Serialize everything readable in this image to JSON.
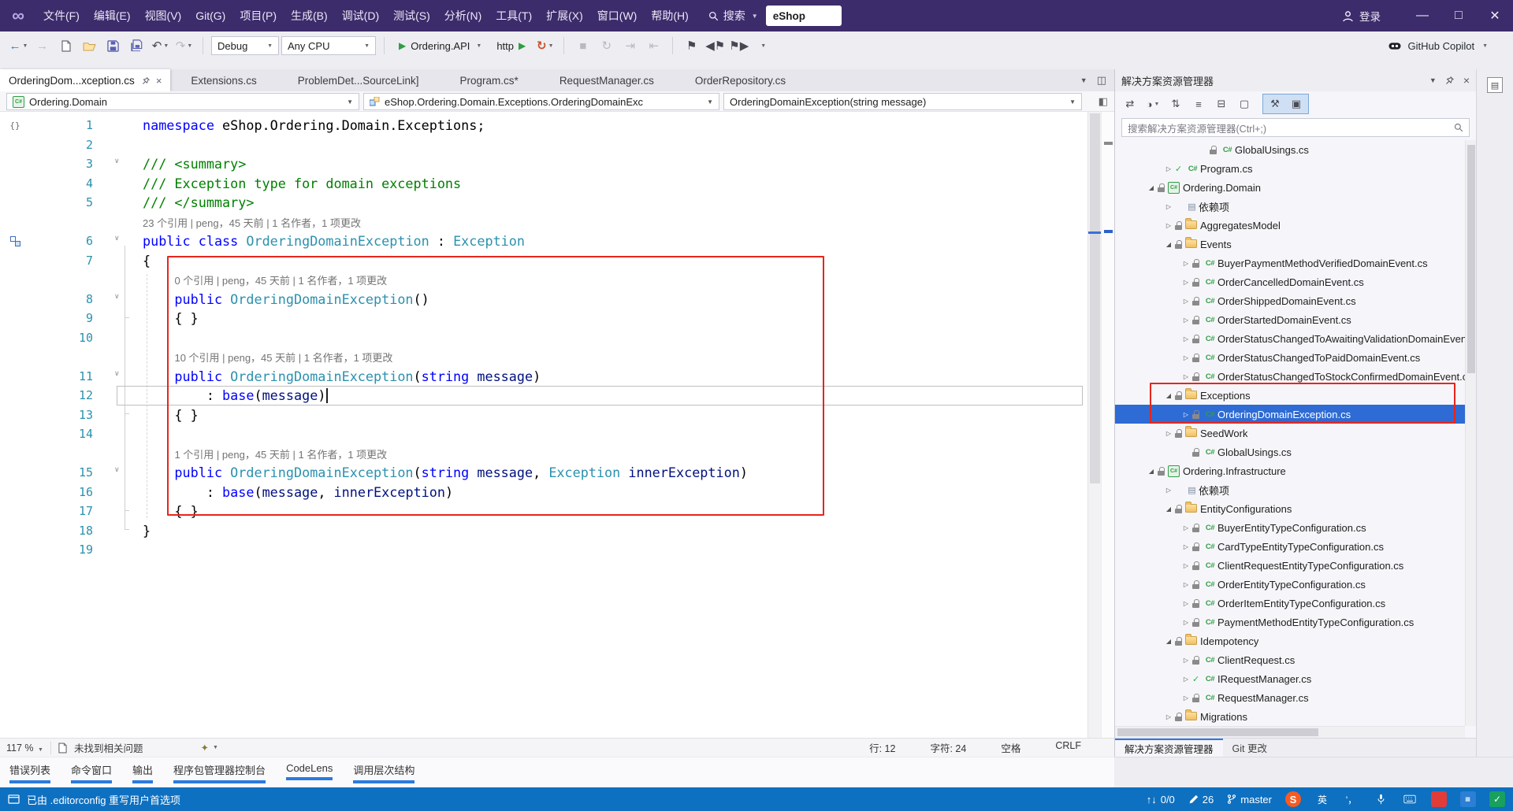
{
  "colors": {
    "accent": "#2e6bd4",
    "titlebar": "#3d2c6b",
    "statusbar": "#0e70c0",
    "annotation_red": "#e8251c",
    "run_green": "#2f9e44"
  },
  "titlebar": {
    "menus": [
      "文件(F)",
      "编辑(E)",
      "视图(V)",
      "Git(G)",
      "项目(P)",
      "生成(B)",
      "调试(D)",
      "测试(S)",
      "分析(N)",
      "工具(T)",
      "扩展(X)",
      "窗口(W)",
      "帮助(H)"
    ],
    "search_label": "搜索",
    "search_value": "eShop",
    "signin_label": "登录"
  },
  "toolbar": {
    "configuration": "Debug",
    "platform": "Any CPU",
    "startup_project": "Ordering.API",
    "launch_profile": "http",
    "copilot_label": "GitHub Copilot"
  },
  "tabstrip": {
    "tabs": [
      {
        "label": "OrderingDom...xception.cs",
        "active": true
      },
      {
        "label": "Extensions.cs",
        "active": false
      },
      {
        "label": "ProblemDet...SourceLink]",
        "active": false
      },
      {
        "label": "Program.cs*",
        "active": false
      },
      {
        "label": "RequestManager.cs",
        "active": false
      },
      {
        "label": "OrderRepository.cs",
        "active": false
      }
    ]
  },
  "navbar": {
    "project": "Ordering.Domain",
    "type": "eShop.Ordering.Domain.Exceptions.OrderingDomainExc",
    "member": "OrderingDomainException(string message)"
  },
  "editor": {
    "current_line": 12,
    "lines": [
      {
        "n": 1,
        "mi": "braces",
        "segs": [
          [
            "k",
            "namespace"
          ],
          [
            "p",
            " eShop.Ordering.Domain.Exceptions;"
          ]
        ]
      },
      {
        "n": 2,
        "segs": []
      },
      {
        "n": 3,
        "fold": true,
        "segs": [
          [
            "c",
            "/// <summary>"
          ]
        ]
      },
      {
        "n": 4,
        "segs": [
          [
            "c",
            "/// Exception type for domain exceptions"
          ]
        ]
      },
      {
        "n": 5,
        "segs": [
          [
            "c",
            "/// </summary>"
          ]
        ]
      },
      {
        "lens": "23 个引用 | peng，45 天前 | 1 名作者，1 项更改",
        "ind": 0
      },
      {
        "n": 6,
        "fold": true,
        "mi": "inherit",
        "segs": [
          [
            "k",
            "public"
          ],
          [
            "p",
            " "
          ],
          [
            "k",
            "class"
          ],
          [
            "p",
            " "
          ],
          [
            "t",
            "OrderingDomainException"
          ],
          [
            "p",
            " : "
          ],
          [
            "t",
            "Exception"
          ]
        ]
      },
      {
        "n": 7,
        "segs": [
          [
            "p",
            "{"
          ]
        ]
      },
      {
        "lens": "0 个引用 | peng，45 天前 | 1 名作者，1 项更改",
        "ind": 4
      },
      {
        "n": 8,
        "fold": true,
        "segs": [
          [
            "p",
            "    "
          ],
          [
            "k",
            "public"
          ],
          [
            "p",
            " "
          ],
          [
            "t",
            "OrderingDomainException"
          ],
          [
            "p",
            "()"
          ]
        ]
      },
      {
        "n": 9,
        "segs": [
          [
            "p",
            "    { }"
          ]
        ]
      },
      {
        "n": 10,
        "segs": []
      },
      {
        "lens": "10 个引用 | peng，45 天前 | 1 名作者，1 项更改",
        "ind": 4
      },
      {
        "n": 11,
        "fold": true,
        "segs": [
          [
            "p",
            "    "
          ],
          [
            "k",
            "public"
          ],
          [
            "p",
            " "
          ],
          [
            "t",
            "OrderingDomainException"
          ],
          [
            "p",
            "("
          ],
          [
            "k",
            "string"
          ],
          [
            "p",
            " "
          ],
          [
            "v",
            "message"
          ],
          [
            "p",
            ")"
          ]
        ]
      },
      {
        "n": 12,
        "cur": true,
        "segs": [
          [
            "p",
            "        : "
          ],
          [
            "k",
            "base"
          ],
          [
            "p",
            "("
          ],
          [
            "v",
            "message"
          ],
          [
            "p",
            ")"
          ]
        ]
      },
      {
        "n": 13,
        "segs": [
          [
            "p",
            "    { }"
          ]
        ]
      },
      {
        "n": 14,
        "segs": []
      },
      {
        "lens": "1 个引用 | peng，45 天前 | 1 名作者，1 项更改",
        "ind": 4
      },
      {
        "n": 15,
        "fold": true,
        "segs": [
          [
            "p",
            "    "
          ],
          [
            "k",
            "public"
          ],
          [
            "p",
            " "
          ],
          [
            "t",
            "OrderingDomainException"
          ],
          [
            "p",
            "("
          ],
          [
            "k",
            "string"
          ],
          [
            "p",
            " "
          ],
          [
            "v",
            "message"
          ],
          [
            "p",
            ", "
          ],
          [
            "t",
            "Exception"
          ],
          [
            "p",
            " "
          ],
          [
            "v",
            "innerException"
          ],
          [
            "p",
            ")"
          ]
        ]
      },
      {
        "n": 16,
        "segs": [
          [
            "p",
            "        : "
          ],
          [
            "k",
            "base"
          ],
          [
            "p",
            "("
          ],
          [
            "v",
            "message"
          ],
          [
            "p",
            ", "
          ],
          [
            "v",
            "innerException"
          ],
          [
            "p",
            ")"
          ]
        ]
      },
      {
        "n": 17,
        "segs": [
          [
            "p",
            "    { }"
          ]
        ]
      },
      {
        "n": 18,
        "segs": [
          [
            "p",
            "}"
          ]
        ]
      },
      {
        "n": 19,
        "segs": []
      }
    ]
  },
  "editor_bar": {
    "zoom": "117 %",
    "health": "未找到相关问题",
    "line": "行: 12",
    "column": "字符: 24",
    "space": "空格",
    "eol": "CRLF"
  },
  "panel_tabs": [
    "错误列表",
    "命令窗口",
    "输出",
    "程序包管理器控制台",
    "CodeLens",
    "调用层次结构"
  ],
  "solution_explorer": {
    "title": "解决方案资源管理器",
    "search_placeholder": "搜索解决方案资源管理器(Ctrl+;)",
    "bottom_tabs": [
      "解决方案资源管理器",
      "Git 更改"
    ],
    "tree": [
      {
        "i": 4,
        "a": "",
        "pre": "lock",
        "ic": "cs",
        "t": "GlobalUsings.cs"
      },
      {
        "i": 2,
        "a": "c",
        "pre": "check",
        "ic": "cs",
        "t": "Program.cs"
      },
      {
        "i": 1,
        "a": "e",
        "pre": "lock",
        "ic": "pr",
        "t": "Ordering.Domain"
      },
      {
        "i": 2,
        "a": "c",
        "pre": "",
        "ic": "de",
        "t": "依赖项"
      },
      {
        "i": 2,
        "a": "c",
        "pre": "lock",
        "ic": "fo",
        "t": "AggregatesModel"
      },
      {
        "i": 2,
        "a": "e",
        "pre": "lock",
        "ic": "fo",
        "t": "Events"
      },
      {
        "i": 3,
        "a": "c",
        "pre": "lock",
        "ic": "cs",
        "t": "BuyerPaymentMethodVerifiedDomainEvent.cs"
      },
      {
        "i": 3,
        "a": "c",
        "pre": "lock",
        "ic": "cs",
        "t": "OrderCancelledDomainEvent.cs"
      },
      {
        "i": 3,
        "a": "c",
        "pre": "lock",
        "ic": "cs",
        "t": "OrderShippedDomainEvent.cs"
      },
      {
        "i": 3,
        "a": "c",
        "pre": "lock",
        "ic": "cs",
        "t": "OrderStartedDomainEvent.cs"
      },
      {
        "i": 3,
        "a": "c",
        "pre": "lock",
        "ic": "cs",
        "t": "OrderStatusChangedToAwaitingValidationDomainEvent.cs"
      },
      {
        "i": 3,
        "a": "c",
        "pre": "lock",
        "ic": "cs",
        "t": "OrderStatusChangedToPaidDomainEvent.cs"
      },
      {
        "i": 3,
        "a": "c",
        "pre": "lock",
        "ic": "cs",
        "t": "OrderStatusChangedToStockConfirmedDomainEvent.cs"
      },
      {
        "i": 2,
        "a": "e",
        "pre": "lock",
        "ic": "fo",
        "t": "Exceptions"
      },
      {
        "i": 3,
        "a": "c",
        "pre": "lock",
        "ic": "cs",
        "t": "OrderingDomainException.cs",
        "sel": true
      },
      {
        "i": 2,
        "a": "c",
        "pre": "lock",
        "ic": "fo",
        "t": "SeedWork"
      },
      {
        "i": 3,
        "a": "",
        "pre": "lock",
        "ic": "cs",
        "t": "GlobalUsings.cs"
      },
      {
        "i": 1,
        "a": "e",
        "pre": "lock",
        "ic": "pr",
        "t": "Ordering.Infrastructure"
      },
      {
        "i": 2,
        "a": "c",
        "pre": "",
        "ic": "de",
        "t": "依赖项"
      },
      {
        "i": 2,
        "a": "e",
        "pre": "lock",
        "ic": "fo",
        "t": "EntityConfigurations"
      },
      {
        "i": 3,
        "a": "c",
        "pre": "lock",
        "ic": "cs",
        "t": "BuyerEntityTypeConfiguration.cs"
      },
      {
        "i": 3,
        "a": "c",
        "pre": "lock",
        "ic": "cs",
        "t": "CardTypeEntityTypeConfiguration.cs"
      },
      {
        "i": 3,
        "a": "c",
        "pre": "lock",
        "ic": "cs",
        "t": "ClientRequestEntityTypeConfiguration.cs"
      },
      {
        "i": 3,
        "a": "c",
        "pre": "lock",
        "ic": "cs",
        "t": "OrderEntityTypeConfiguration.cs"
      },
      {
        "i": 3,
        "a": "c",
        "pre": "lock",
        "ic": "cs",
        "t": "OrderItemEntityTypeConfiguration.cs"
      },
      {
        "i": 3,
        "a": "c",
        "pre": "lock",
        "ic": "cs",
        "t": "PaymentMethodEntityTypeConfiguration.cs"
      },
      {
        "i": 2,
        "a": "e",
        "pre": "lock",
        "ic": "fo",
        "t": "Idempotency"
      },
      {
        "i": 3,
        "a": "c",
        "pre": "lock",
        "ic": "cs",
        "t": "ClientRequest.cs"
      },
      {
        "i": 3,
        "a": "c",
        "pre": "check",
        "ic": "cs",
        "t": "IRequestManager.cs"
      },
      {
        "i": 3,
        "a": "c",
        "pre": "lock",
        "ic": "cs",
        "t": "RequestManager.cs"
      },
      {
        "i": 2,
        "a": "c",
        "pre": "lock",
        "ic": "fo",
        "t": "Migrations"
      }
    ]
  },
  "statusbar": {
    "message": "已由 .editorconfig 重写用户首选项",
    "sync": "0/0",
    "edits": "26",
    "branch": "master",
    "ime_lang": "英",
    "ime_punct": "'，"
  }
}
